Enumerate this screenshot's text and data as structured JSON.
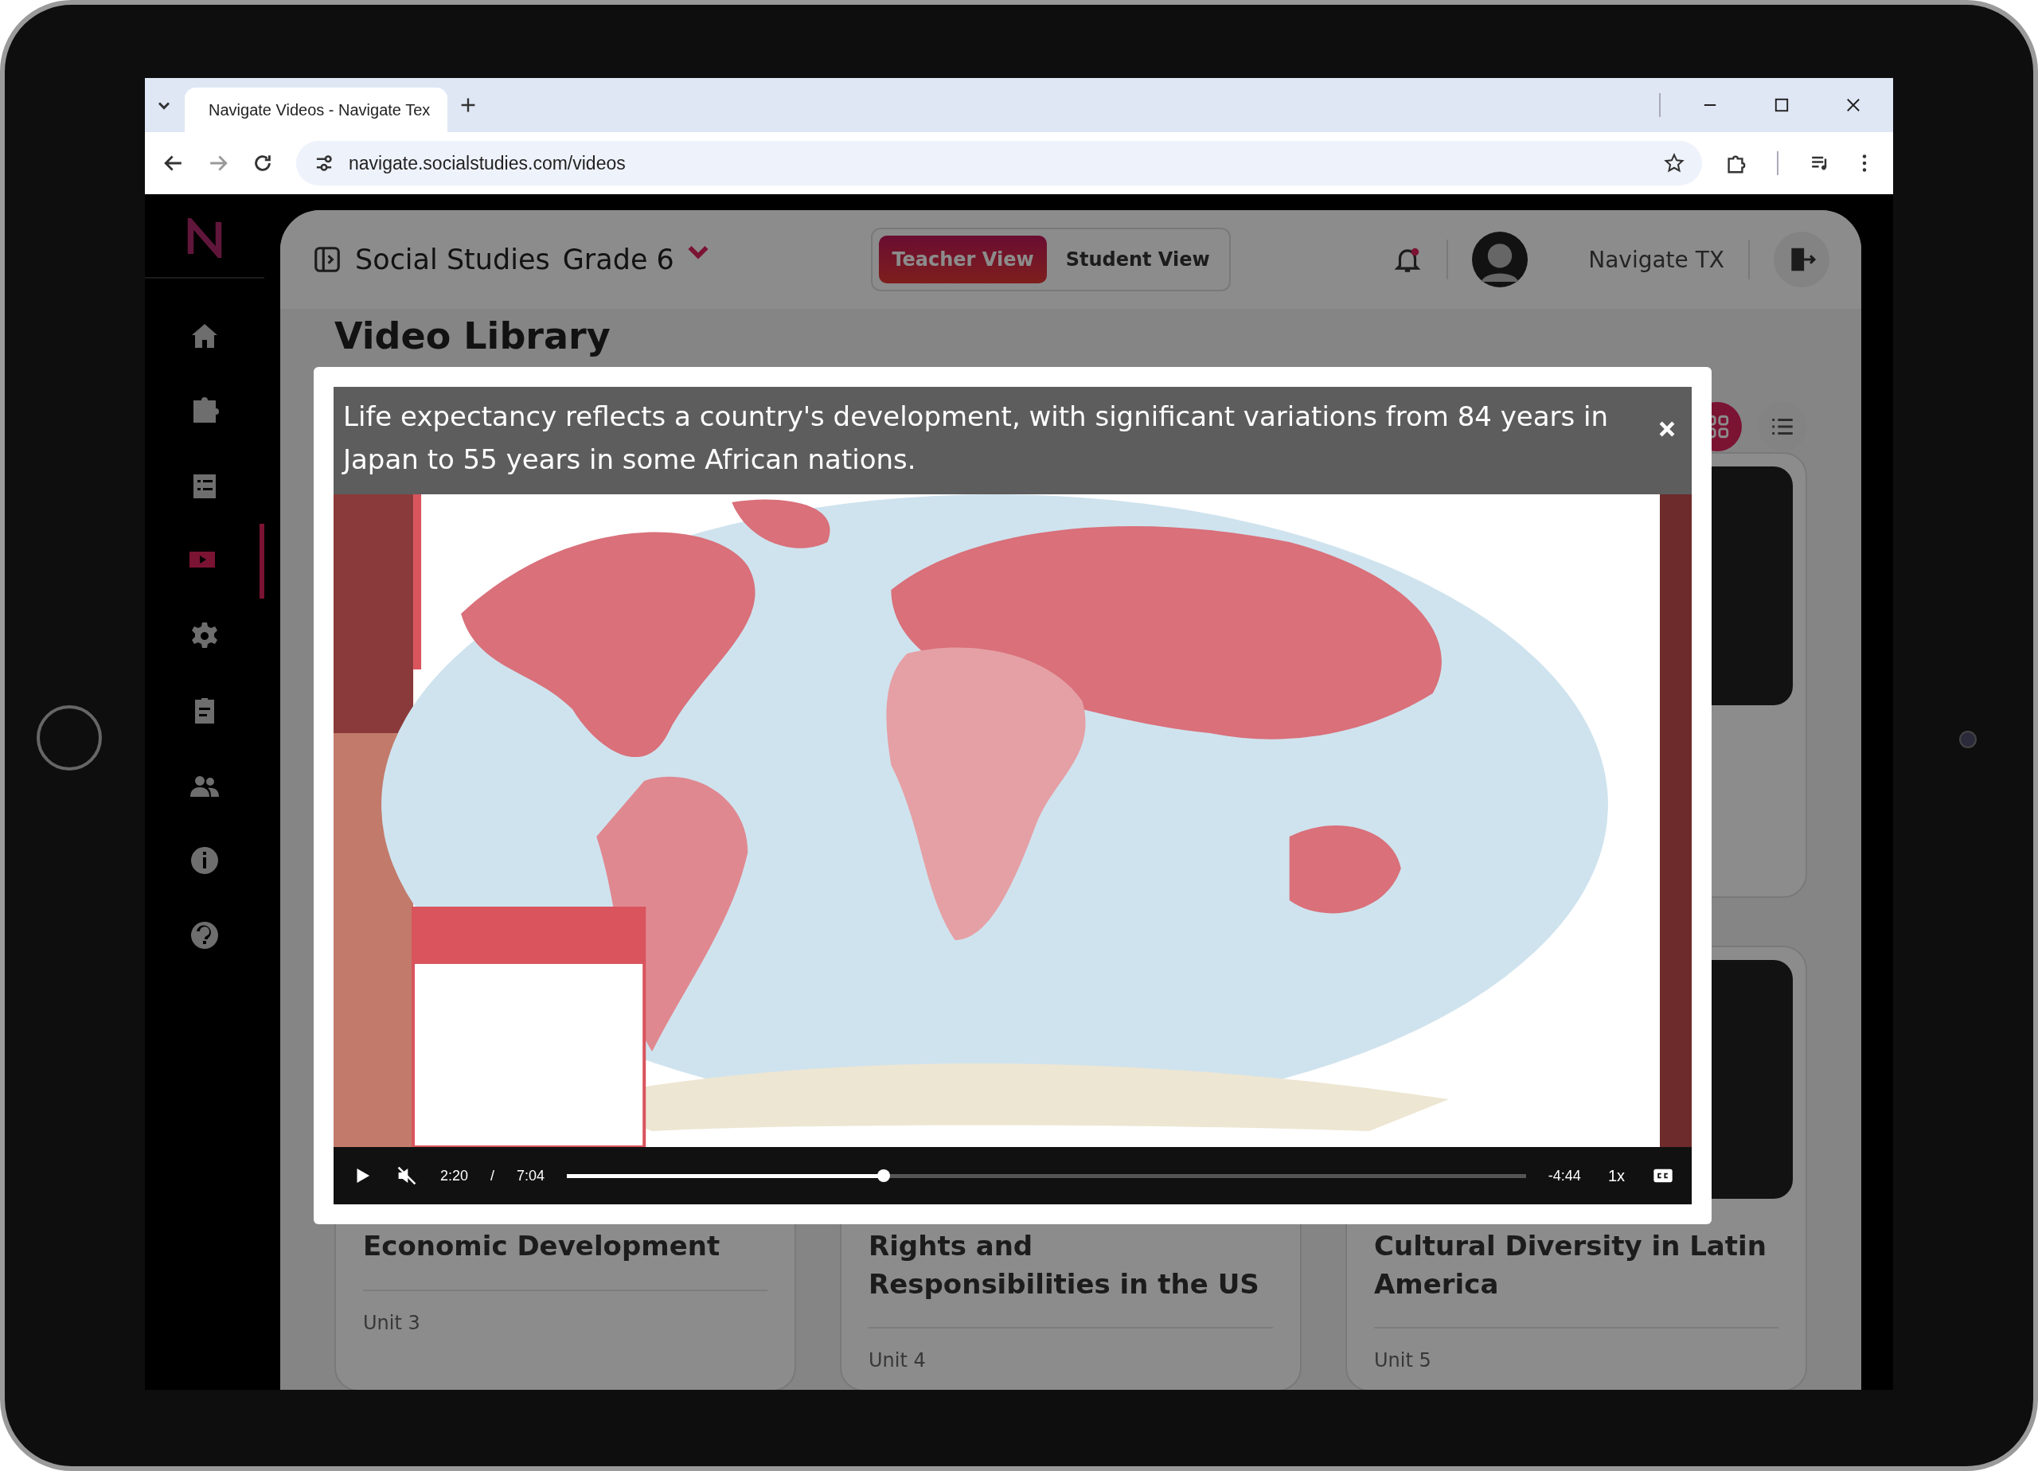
{
  "browser": {
    "tab_title": "Navigate Videos - Navigate Tex",
    "url": "navigate.socialstudies.com/videos"
  },
  "sidebar": {
    "items": [
      {
        "selected": false
      },
      {
        "selected": false
      },
      {
        "selected": false
      },
      {
        "selected": true
      },
      {
        "selected": false
      },
      {
        "selected": false
      },
      {
        "selected": false
      },
      {
        "selected": false
      },
      {
        "selected": false
      }
    ]
  },
  "header": {
    "course": "Social Studies",
    "grade": "Grade 6",
    "views": [
      {
        "label": "Teacher View",
        "selected": true
      },
      {
        "label": "Student View",
        "selected": false
      }
    ],
    "account": "Navigate TX"
  },
  "page_title": "Video Library",
  "layout_toggle": [
    {
      "selected": true
    },
    {
      "selected": false
    }
  ],
  "cards": [
    {
      "title": "Economic Development",
      "unit": "Unit 3"
    },
    {
      "title": "Rights and Responsibilities in the US",
      "unit": "Unit 4"
    },
    {
      "title": "Cultural Diversity in Latin America",
      "unit": "Unit 5"
    }
  ],
  "video": {
    "caption": "Life expectancy reflects a country's development, with significant variations from 84 years in Japan to 55 years in some African nations.",
    "elapsed": "2:20",
    "separator": "/",
    "duration": "7:04",
    "level": 0.33,
    "remaining": "-4:44",
    "speed": "1x"
  }
}
